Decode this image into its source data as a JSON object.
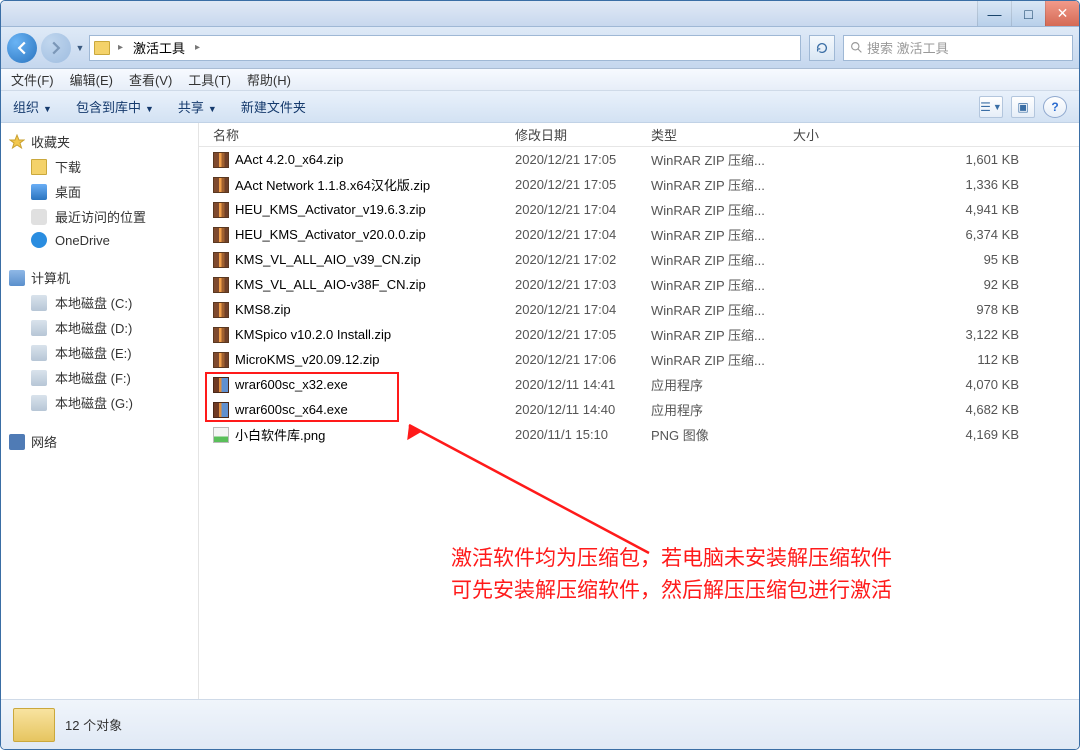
{
  "titlebar": {
    "min": "—",
    "max": "□",
    "close": "✕"
  },
  "breadcrumb": {
    "folder_label": "激活工具",
    "sep": "▸"
  },
  "search": {
    "placeholder": "搜索 激活工具"
  },
  "menubar": {
    "file": "文件(F)",
    "edit": "编辑(E)",
    "view": "查看(V)",
    "tools": "工具(T)",
    "help": "帮助(H)"
  },
  "cmdbar": {
    "organize": "组织",
    "include": "包含到库中",
    "share": "共享",
    "newfolder": "新建文件夹",
    "drop": "▼"
  },
  "sidebar": {
    "favorites": "收藏夹",
    "fav_items": [
      "下载",
      "桌面",
      "最近访问的位置",
      "OneDrive"
    ],
    "fav_icons": [
      "folder",
      "desktop",
      "recent",
      "cloud"
    ],
    "computer": "计算机",
    "drives": [
      "本地磁盘 (C:)",
      "本地磁盘 (D:)",
      "本地磁盘 (E:)",
      "本地磁盘 (F:)",
      "本地磁盘 (G:)"
    ],
    "network": "网络"
  },
  "columns": {
    "name": "名称",
    "date": "修改日期",
    "type": "类型",
    "size": "大小"
  },
  "files": [
    {
      "icon": "zip",
      "name": "AAct 4.2.0_x64.zip",
      "date": "2020/12/21 17:05",
      "type": "WinRAR ZIP 压缩...",
      "size": "1,601 KB"
    },
    {
      "icon": "zip",
      "name": "AAct Network 1.1.8.x64汉化版.zip",
      "date": "2020/12/21 17:05",
      "type": "WinRAR ZIP 压缩...",
      "size": "1,336 KB"
    },
    {
      "icon": "zip",
      "name": "HEU_KMS_Activator_v19.6.3.zip",
      "date": "2020/12/21 17:04",
      "type": "WinRAR ZIP 压缩...",
      "size": "4,941 KB"
    },
    {
      "icon": "zip",
      "name": "HEU_KMS_Activator_v20.0.0.zip",
      "date": "2020/12/21 17:04",
      "type": "WinRAR ZIP 压缩...",
      "size": "6,374 KB"
    },
    {
      "icon": "zip",
      "name": "KMS_VL_ALL_AIO_v39_CN.zip",
      "date": "2020/12/21 17:02",
      "type": "WinRAR ZIP 压缩...",
      "size": "95 KB"
    },
    {
      "icon": "zip",
      "name": "KMS_VL_ALL_AIO-v38F_CN.zip",
      "date": "2020/12/21 17:03",
      "type": "WinRAR ZIP 压缩...",
      "size": "92 KB"
    },
    {
      "icon": "zip",
      "name": "KMS8.zip",
      "date": "2020/12/21 17:04",
      "type": "WinRAR ZIP 压缩...",
      "size": "978 KB"
    },
    {
      "icon": "zip",
      "name": "KMSpico v10.2.0 Install.zip",
      "date": "2020/12/21 17:05",
      "type": "WinRAR ZIP 压缩...",
      "size": "3,122 KB"
    },
    {
      "icon": "zip",
      "name": "MicroKMS_v20.09.12.zip",
      "date": "2020/12/21 17:06",
      "type": "WinRAR ZIP 压缩...",
      "size": "112 KB"
    },
    {
      "icon": "exe",
      "name": "wrar600sc_x32.exe",
      "date": "2020/12/11 14:41",
      "type": "应用程序",
      "size": "4,070 KB"
    },
    {
      "icon": "exe",
      "name": "wrar600sc_x64.exe",
      "date": "2020/12/11 14:40",
      "type": "应用程序",
      "size": "4,682 KB"
    },
    {
      "icon": "png",
      "name": "小白软件库.png",
      "date": "2020/11/1 15:10",
      "type": "PNG 图像",
      "size": "4,169 KB"
    }
  ],
  "status": {
    "count": "12 个对象"
  },
  "annotation": {
    "line1": "激活软件均为压缩包，若电脑未安装解压缩软件",
    "line2": "可先安装解压缩软件，然后解压压缩包进行激活"
  }
}
